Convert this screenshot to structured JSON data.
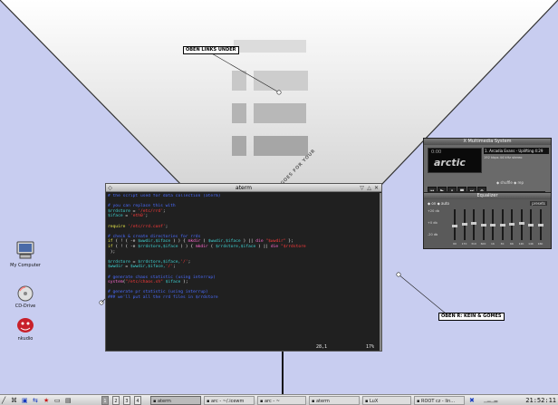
{
  "wallpaper": {
    "callout_top": "OBEN LINKS UNDER",
    "callout_right": "OBEN R: KEIN & GOMES",
    "diag_text": "KEIN TA LUCK WHAT GOES FOR YOUR"
  },
  "desktop_icons": [
    {
      "label": "My Computer",
      "icon": "computer-icon"
    },
    {
      "label": "CD-Drive",
      "icon": "cd-drive-icon"
    },
    {
      "label": "nkudio",
      "icon": "gnome-icon"
    }
  ],
  "terminal": {
    "title": "aterm",
    "lines": [
      [
        {
          "c": "cm",
          "t": "# the script used for data collection (aterm)"
        }
      ],
      [
        {
          "c": "tx",
          "t": ""
        }
      ],
      [
        {
          "c": "cm",
          "t": "# you can replace this with"
        }
      ],
      [
        {
          "c": "vr",
          "t": "$rrdstore"
        },
        {
          "c": "tx",
          "t": " = "
        },
        {
          "c": "st",
          "t": "'/etc/rrd'"
        },
        {
          "c": "tx",
          "t": ";"
        }
      ],
      [
        {
          "c": "vr",
          "t": "$iface"
        },
        {
          "c": "tx",
          "t": " = "
        },
        {
          "c": "st",
          "t": "'eth0'"
        },
        {
          "c": "tx",
          "t": ";"
        }
      ],
      [
        {
          "c": "tx",
          "t": ""
        }
      ],
      [
        {
          "c": "kw",
          "t": "require"
        },
        {
          "c": "tx",
          "t": " "
        },
        {
          "c": "st",
          "t": "'/etc/rrd.conf'"
        },
        {
          "c": "tx",
          "t": ";"
        }
      ],
      [
        {
          "c": "tx",
          "t": ""
        }
      ],
      [
        {
          "c": "cm",
          "t": "# check & create directories for rrds"
        }
      ],
      [
        {
          "c": "kw",
          "t": "if"
        },
        {
          "c": "tx",
          "t": " ( ! ( -e "
        },
        {
          "c": "vr",
          "t": "$wwdir,$iface"
        },
        {
          "c": "tx",
          "t": " ) ) { "
        },
        {
          "c": "fn",
          "t": "mkdir"
        },
        {
          "c": "tx",
          "t": " ( "
        },
        {
          "c": "vr",
          "t": "$wwdir,$iface"
        },
        {
          "c": "tx",
          "t": " ) || "
        },
        {
          "c": "fn",
          "t": "die"
        },
        {
          "c": "tx",
          "t": " "
        },
        {
          "c": "st",
          "t": "\"$wwdir\""
        },
        {
          "c": "tx",
          "t": " };"
        }
      ],
      [
        {
          "c": "kw",
          "t": "if"
        },
        {
          "c": "tx",
          "t": " ( ! ( -e "
        },
        {
          "c": "vr",
          "t": "$rrdstore,$iface"
        },
        {
          "c": "tx",
          "t": " ) ) { "
        },
        {
          "c": "fn",
          "t": "mkdir"
        },
        {
          "c": "tx",
          "t": " ( "
        },
        {
          "c": "vr",
          "t": "$rrdstore,$iface"
        },
        {
          "c": "tx",
          "t": " ) || "
        },
        {
          "c": "fn",
          "t": "die"
        },
        {
          "c": "tx",
          "t": " "
        },
        {
          "c": "st",
          "t": "\"$rrdstore"
        }
      ],
      [
        {
          "c": "tx",
          "t": " );"
        }
      ],
      [
        {
          "c": "tx",
          "t": ""
        }
      ],
      [
        {
          "c": "vr",
          "t": "$rrdstore"
        },
        {
          "c": "tx",
          "t": " = "
        },
        {
          "c": "vr",
          "t": "$rrdstore,$iface,"
        },
        {
          "c": "st",
          "t": "'/'"
        },
        {
          "c": "tx",
          "t": ";"
        }
      ],
      [
        {
          "c": "vr",
          "t": "$wwdir"
        },
        {
          "c": "tx",
          "t": " = "
        },
        {
          "c": "vr",
          "t": "$wwdir,$iface,"
        },
        {
          "c": "st",
          "t": "'/'"
        },
        {
          "c": "tx",
          "t": ";"
        }
      ],
      [
        {
          "c": "tx",
          "t": ""
        }
      ],
      [
        {
          "c": "cm",
          "t": "# generate chaos statistic (using interrup)"
        }
      ],
      [
        {
          "c": "fn",
          "t": "system"
        },
        {
          "c": "tx",
          "t": "("
        },
        {
          "c": "st",
          "t": "\"/etc/chaos.sh\""
        },
        {
          "c": "tx",
          "t": " "
        },
        {
          "c": "vr",
          "t": "$iface"
        },
        {
          "c": "tx",
          "t": " );"
        }
      ],
      [
        {
          "c": "tx",
          "t": ""
        }
      ],
      [
        {
          "c": "cm",
          "t": "# generate pr statistic (using interrup)"
        }
      ],
      [
        {
          "c": "cm",
          "t": "### we'll put all the rrd files in $rrdstore"
        }
      ]
    ],
    "status_pos": "28,1",
    "status_pct": "17%"
  },
  "xmms": {
    "title": "X Multimedia System",
    "logo": "arctic",
    "time": "0:00",
    "song": "1. Arcadia Evans - Uplifting 4:29",
    "rates": "192 kbps  44 kHz  stereo",
    "controls": [
      "prev",
      "play",
      "pause",
      "stop",
      "next",
      "eject"
    ],
    "options": "◆ shuffle  ◆ rep",
    "seek_fraction": 0.0
  },
  "equalizer": {
    "title": "Equalizer",
    "toggles": "◆ on  ◆ auto",
    "presets": "presets",
    "preamp_labels": [
      "+20 db",
      "+0 db",
      "-20 db"
    ],
    "bands": [
      {
        "label": "60",
        "level": 0.45
      },
      {
        "label": "170",
        "level": 0.52
      },
      {
        "label": "310",
        "level": 0.55
      },
      {
        "label": "600",
        "level": 0.5
      },
      {
        "label": "1K",
        "level": 0.48
      },
      {
        "label": "3K",
        "level": 0.5
      },
      {
        "label": "6K",
        "level": 0.52
      },
      {
        "label": "12K",
        "level": 0.55
      },
      {
        "label": "14K",
        "level": 0.5
      },
      {
        "label": "16K",
        "level": 0.48
      }
    ]
  },
  "taskbar": {
    "launchers": [
      "slash-icon",
      "run-icon",
      "terminal-icon",
      "network-icon",
      "star-icon",
      "file-icon",
      "monitor-icon"
    ],
    "pager": [
      "1",
      "2",
      "3",
      "4"
    ],
    "tasks": [
      "aterm",
      "arc - ~/.icewm",
      "arc - ~",
      "aterm",
      "LuX",
      "ROOT cz - lin..."
    ],
    "clock": "21:52:11"
  }
}
